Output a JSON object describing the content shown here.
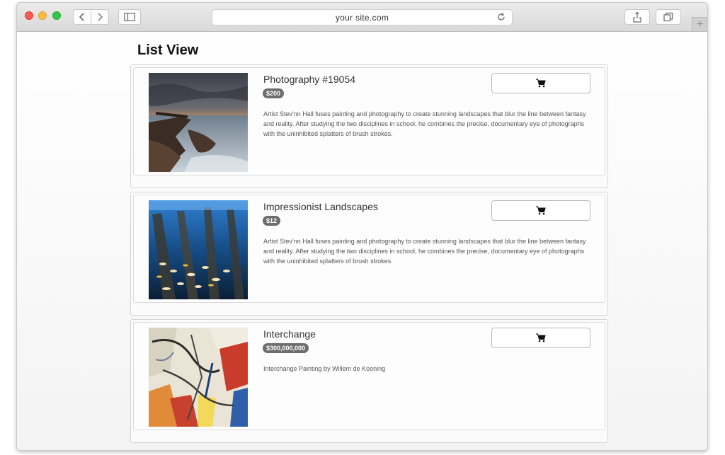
{
  "browser": {
    "url": "your site.com"
  },
  "page": {
    "title": "List View"
  },
  "products": [
    {
      "title": "Photography #19054",
      "price": "$200",
      "description": "Artist Stev'nn Hall fuses painting and photography to create stunning landscapes that blur the line between fantasy and reality. After studying the two disciplines in school, he combines the precise, documentary eye of photographs with the uninhibited splatters of brush strokes."
    },
    {
      "title": "Impressionist Landscapes",
      "price": "$12",
      "description": "Artist Stev'nn Hall fuses painting and photography to create stunning landscapes that blur the line between fantasy and reality. After studying the two disciplines in school, he combines the precise, documentary eye of photographs with the uninhibited splatters of brush strokes."
    },
    {
      "title": "Interchange",
      "price": "$300,000,000",
      "description": "Interchange Painting by Willem de Kooning"
    }
  ],
  "icons": {
    "cart": "shopping-cart-icon",
    "back": "chevron-left-icon",
    "forward": "chevron-right-icon",
    "sidebar": "sidebar-icon",
    "reload": "reload-icon",
    "share": "share-icon",
    "tabs": "tabs-icon",
    "new_tab": "plus-icon"
  },
  "colors": {
    "badge": "#6d6d6d",
    "traffic_red": "#fc5753",
    "traffic_yellow": "#fdbc40",
    "traffic_green": "#33c748"
  }
}
